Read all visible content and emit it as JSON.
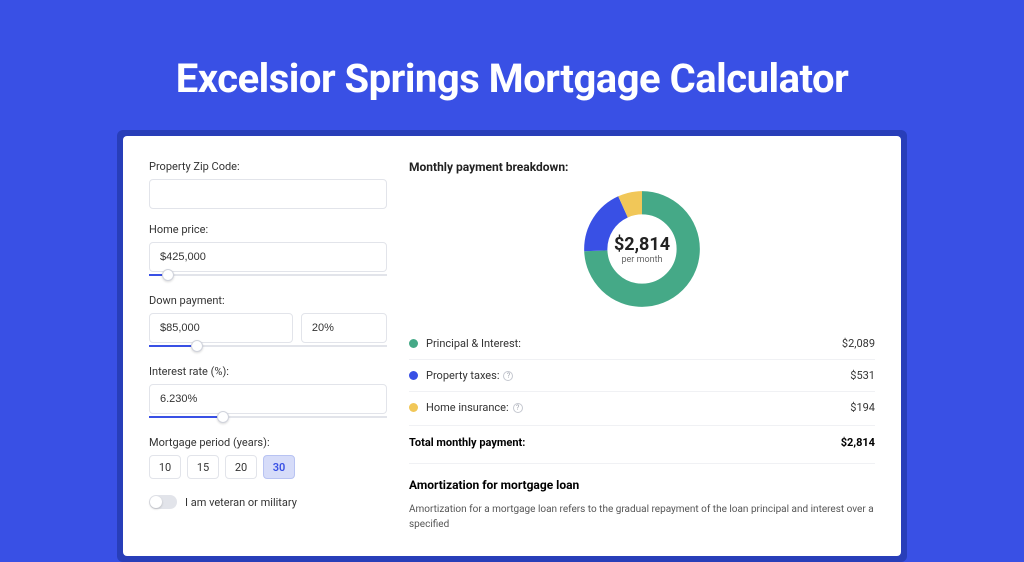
{
  "hero": {
    "title": "Excelsior Springs Mortgage Calculator"
  },
  "form": {
    "zip_label": "Property Zip Code:",
    "zip_value": "",
    "price_label": "Home price:",
    "price_value": "$425,000",
    "price_slider_pct": 8,
    "down_label": "Down payment:",
    "down_value": "$85,000",
    "down_pct_value": "20%",
    "down_slider_pct": 20,
    "rate_label": "Interest rate (%):",
    "rate_value": "6.230%",
    "rate_slider_pct": 31,
    "period_label": "Mortgage period (years):",
    "periods": [
      "10",
      "15",
      "20",
      "30"
    ],
    "period_active": "30",
    "veteran_label": "I am veteran or military"
  },
  "breakdown": {
    "title": "Monthly payment breakdown:",
    "amount": "$2,814",
    "sub": "per month",
    "items": [
      {
        "label": "Principal & Interest:",
        "value": "$2,089",
        "color": "#45a987",
        "help": false
      },
      {
        "label": "Property taxes:",
        "value": "$531",
        "color": "#3950e5",
        "help": true
      },
      {
        "label": "Home insurance:",
        "value": "$194",
        "color": "#f1c758",
        "help": true
      }
    ],
    "total_label": "Total monthly payment:",
    "total_value": "$2,814"
  },
  "chart_data": {
    "type": "pie",
    "title": "Monthly payment breakdown",
    "series": [
      {
        "name": "Principal & Interest",
        "value": 2089,
        "color": "#45a987"
      },
      {
        "name": "Property taxes",
        "value": 531,
        "color": "#3950e5"
      },
      {
        "name": "Home insurance",
        "value": 194,
        "color": "#f1c758"
      }
    ],
    "total": 2814,
    "center_label": "$2,814",
    "center_sub": "per month"
  },
  "amort": {
    "title": "Amortization for mortgage loan",
    "text": "Amortization for a mortgage loan refers to the gradual repayment of the loan principal and interest over a specified"
  }
}
